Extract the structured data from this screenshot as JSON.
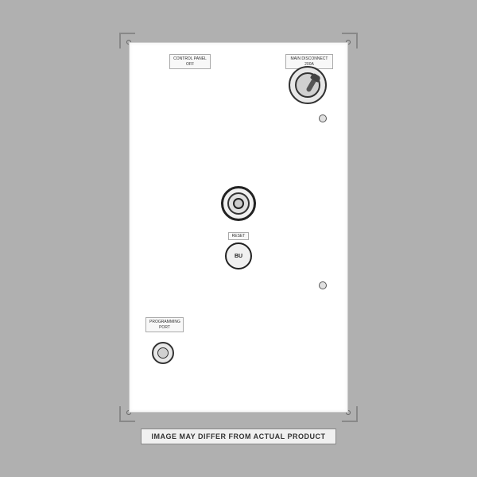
{
  "panel": {
    "background_color": "#b0b0b0",
    "panel_color": "#ffffff"
  },
  "labels": {
    "control_panel": "CONTROL PANEL\nOFF",
    "main_disconnect": "MAIN DISCONNECT\n200A",
    "reset": "RESET",
    "reset_button_text": "BU",
    "programming_port": "PROGRAMMING\nPORT"
  },
  "disclaimer": {
    "text": "IMAGE MAY DIFFER FROM ACTUAL PRODUCT"
  }
}
